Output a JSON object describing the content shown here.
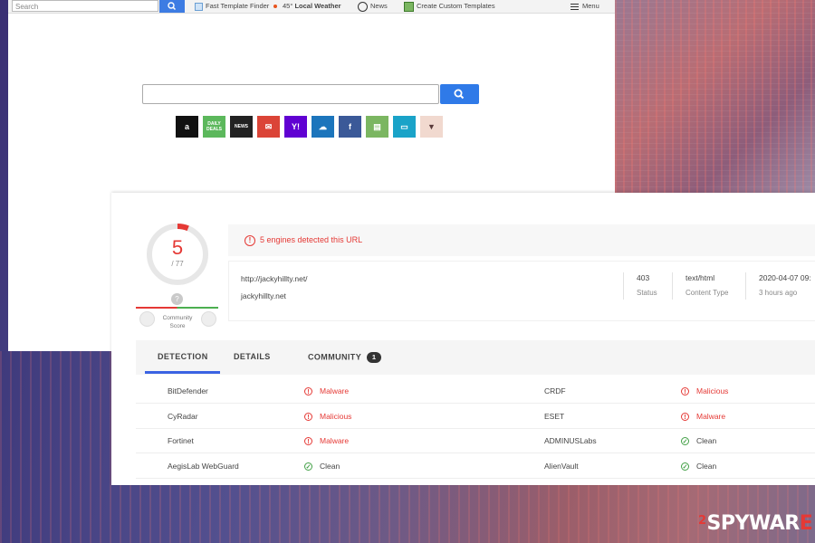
{
  "toolbar": {
    "search_placeholder": "Search",
    "fast_template": "Fast Template Finder",
    "weather_temp": "45°",
    "weather_label": "Local Weather",
    "news": "News",
    "create_templates": "Create Custom Templates",
    "menu": "Menu"
  },
  "shortcuts": [
    {
      "icon": "amazon-icon",
      "glyph": "a",
      "bg": "#111111"
    },
    {
      "icon": "daily-deals-icon",
      "glyph": "DAILY DEALS",
      "bg": "#5cb85c"
    },
    {
      "icon": "news-icon",
      "glyph": "NEWS",
      "bg": "#222222"
    },
    {
      "icon": "gmail-icon",
      "glyph": "✉",
      "bg": "#db4437"
    },
    {
      "icon": "yahoo-icon",
      "glyph": "Y!",
      "bg": "#6001d2"
    },
    {
      "icon": "weather-icon",
      "glyph": "☁",
      "bg": "#1c75bc"
    },
    {
      "icon": "facebook-icon",
      "glyph": "f",
      "bg": "#3b5998"
    },
    {
      "icon": "template-icon",
      "glyph": "▤",
      "bg": "#7bb661"
    },
    {
      "icon": "card-icon",
      "glyph": "▭",
      "bg": "#1aa3c8"
    },
    {
      "icon": "tie-icon",
      "glyph": "▼",
      "bg": "#f1d9cf"
    }
  ],
  "vt": {
    "score": "5",
    "score_total": "/ 77",
    "community_q": "?",
    "community_label_1": "Community",
    "community_label_2": "Score",
    "alert_icon": "!",
    "alert": "5 engines detected this URL",
    "url": "http://jackyhillty.net/",
    "domain": "jackyhillty.net",
    "status_value": "403",
    "status_label": "Status",
    "content_value": "text/html",
    "content_label": "Content Type",
    "date_value": "2020-04-07 09:",
    "date_label": "3 hours ago",
    "tabs": {
      "detection": "DETECTION",
      "details": "DETAILS",
      "community": "COMMUNITY",
      "community_count": "1"
    },
    "rows": [
      {
        "l_engine": "BitDefender",
        "l_result": "Malware",
        "l_status": "bad",
        "r_engine": "CRDF",
        "r_result": "Malicious",
        "r_status": "bad"
      },
      {
        "l_engine": "CyRadar",
        "l_result": "Malicious",
        "l_status": "bad",
        "r_engine": "ESET",
        "r_result": "Malware",
        "r_status": "bad"
      },
      {
        "l_engine": "Fortinet",
        "l_result": "Malware",
        "l_status": "bad",
        "r_engine": "ADMINUSLabs",
        "r_result": "Clean",
        "r_status": "good"
      },
      {
        "l_engine": "AegisLab WebGuard",
        "l_result": "Clean",
        "l_status": "good",
        "r_engine": "AlienVault",
        "r_result": "Clean",
        "r_status": "good"
      }
    ]
  },
  "watermark": {
    "num": "2",
    "text": "SPYWAR",
    "end": "E"
  },
  "colors": {
    "accent_red": "#e53935",
    "accent_blue": "#3b63e3",
    "clean_green": "#43a047"
  }
}
